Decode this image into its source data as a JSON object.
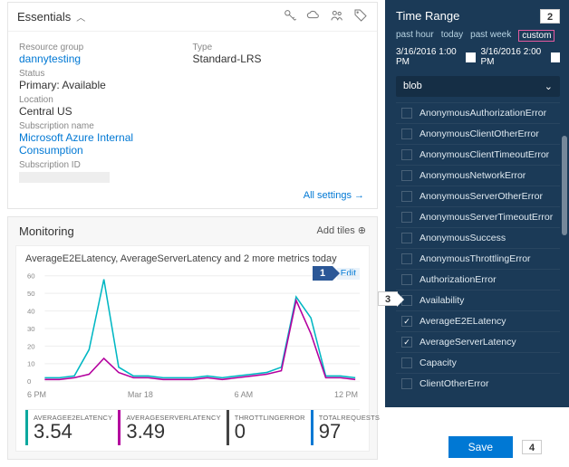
{
  "essentials": {
    "header": "Essentials",
    "resource_group_label": "Resource group",
    "resource_group": "dannytesting",
    "status_label": "Status",
    "status": "Primary: Available",
    "location_label": "Location",
    "location": "Central US",
    "subscription_name_label": "Subscription name",
    "subscription_name": "Microsoft Azure Internal Consumption",
    "subscription_id_label": "Subscription ID",
    "type_label": "Type",
    "type": "Standard-LRS",
    "all_settings": "All settings →"
  },
  "monitoring": {
    "header": "Monitoring",
    "add_tiles": "Add tiles ⊕",
    "chart_title": "AverageE2ELatency, AverageServerLatency and 2 more metrics today",
    "edit": "Edit"
  },
  "chart_data": {
    "type": "line",
    "ylim": [
      0,
      60
    ],
    "yticks": [
      0,
      10,
      20,
      30,
      40,
      50,
      60
    ],
    "xticks": [
      "6 PM",
      "Mar 18",
      "6 AM",
      "12 PM"
    ],
    "x": [
      0,
      1,
      2,
      3,
      4,
      5,
      6,
      7,
      8,
      9,
      10,
      11,
      12,
      13,
      14,
      15,
      16,
      17,
      18,
      19,
      20,
      21
    ],
    "series": [
      {
        "name": "AverageE2ELatency",
        "color": "#00b7c3",
        "values": [
          2,
          2,
          3,
          18,
          58,
          8,
          3,
          3,
          2,
          2,
          2,
          3,
          2,
          3,
          4,
          5,
          8,
          48,
          36,
          3,
          3,
          2
        ]
      },
      {
        "name": "AverageServerLatency",
        "color": "#b4009e",
        "values": [
          1,
          1,
          2,
          4,
          13,
          5,
          2,
          2,
          1,
          1,
          1,
          2,
          1,
          2,
          3,
          4,
          6,
          46,
          27,
          2,
          2,
          1
        ]
      }
    ]
  },
  "metrics": [
    {
      "label": "AVERAGEE2ELATENCY",
      "value": "3.54"
    },
    {
      "label": "AVERAGESERVERLATENCY",
      "value": "3.49"
    },
    {
      "label": "THROTTLINGERROR",
      "value": "0"
    },
    {
      "label": "TOTALREQUESTS",
      "value": "97"
    }
  ],
  "side": {
    "title": "Time Range",
    "tabs": [
      "past hour",
      "today",
      "past week",
      "custom"
    ],
    "active_tab": "custom",
    "from": "3/16/2016 1:00 PM",
    "to": "3/16/2016 2:00 PM",
    "select": "blob",
    "items": [
      {
        "label": "AnonymousAuthorizationError",
        "checked": false
      },
      {
        "label": "AnonymousClientOtherError",
        "checked": false
      },
      {
        "label": "AnonymousClientTimeoutError",
        "checked": false
      },
      {
        "label": "AnonymousNetworkError",
        "checked": false
      },
      {
        "label": "AnonymousServerOtherError",
        "checked": false
      },
      {
        "label": "AnonymousServerTimeoutError",
        "checked": false
      },
      {
        "label": "AnonymousSuccess",
        "checked": false
      },
      {
        "label": "AnonymousThrottlingError",
        "checked": false
      },
      {
        "label": "AuthorizationError",
        "checked": false
      },
      {
        "label": "Availability",
        "checked": false
      },
      {
        "label": "AverageE2ELatency",
        "checked": true
      },
      {
        "label": "AverageServerLatency",
        "checked": true
      },
      {
        "label": "Capacity",
        "checked": false
      },
      {
        "label": "ClientOtherError",
        "checked": false
      }
    ],
    "save": "Save"
  },
  "callouts": {
    "c1": "1",
    "c2": "2",
    "c3": "3",
    "c4": "4"
  }
}
